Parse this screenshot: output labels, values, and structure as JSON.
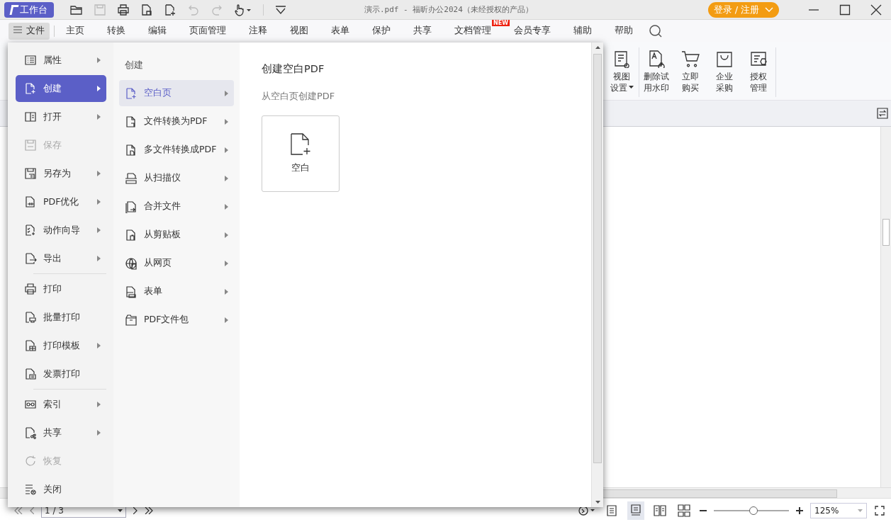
{
  "title_bar": {
    "workbench": "工作台",
    "title": "演示.pdf - 福昕办公2024（未经授权的产品）",
    "login": "登录 / 注册"
  },
  "menu_bar": [
    {
      "label": "文件",
      "selected": true
    },
    {
      "label": "主页",
      "selected": false
    },
    {
      "label": "转换",
      "selected": false
    },
    {
      "label": "编辑",
      "selected": false
    },
    {
      "label": "页面管理",
      "selected": false
    },
    {
      "label": "注释",
      "selected": false
    },
    {
      "label": "视图",
      "selected": false
    },
    {
      "label": "表单",
      "selected": false
    },
    {
      "label": "保护",
      "selected": false
    },
    {
      "label": "共享",
      "selected": false
    },
    {
      "label": "文档管理",
      "selected": false,
      "badge": "NEW"
    },
    {
      "label": "会员专享",
      "selected": false
    },
    {
      "label": "辅助",
      "selected": false
    },
    {
      "label": "帮助",
      "selected": false
    }
  ],
  "ribbon": [
    {
      "lines": [
        "视图",
        "设置"
      ],
      "dropdown": true
    },
    {
      "lines": [
        "删除试",
        "用水印"
      ],
      "dropdown": false
    },
    {
      "lines": [
        "立即",
        "购买"
      ],
      "dropdown": false
    },
    {
      "lines": [
        "企业",
        "采购"
      ],
      "dropdown": false
    },
    {
      "lines": [
        "授权",
        "管理"
      ],
      "dropdown": false
    }
  ],
  "file_menu": {
    "groups": [
      [
        {
          "label": "属性",
          "arrow": true,
          "selected": false,
          "disabled": false
        },
        {
          "label": "创建",
          "arrow": true,
          "selected": true,
          "disabled": false
        },
        {
          "label": "打开",
          "arrow": true,
          "selected": false,
          "disabled": false
        },
        {
          "label": "保存",
          "arrow": false,
          "selected": false,
          "disabled": true
        },
        {
          "label": "另存为",
          "arrow": true,
          "selected": false,
          "disabled": false
        },
        {
          "label": "PDF优化",
          "arrow": true,
          "selected": false,
          "disabled": false
        },
        {
          "label": "动作向导",
          "arrow": true,
          "selected": false,
          "disabled": false
        },
        {
          "label": "导出",
          "arrow": true,
          "selected": false,
          "disabled": false
        }
      ],
      [
        {
          "label": "打印",
          "arrow": false,
          "selected": false,
          "disabled": false
        },
        {
          "label": "批量打印",
          "arrow": false,
          "selected": false,
          "disabled": false
        },
        {
          "label": "打印模板",
          "arrow": true,
          "selected": false,
          "disabled": false
        },
        {
          "label": "发票打印",
          "arrow": false,
          "selected": false,
          "disabled": false
        }
      ],
      [
        {
          "label": "索引",
          "arrow": true,
          "selected": false,
          "disabled": false
        },
        {
          "label": "共享",
          "arrow": true,
          "selected": false,
          "disabled": false
        },
        {
          "label": "恢复",
          "arrow": false,
          "selected": false,
          "disabled": true
        },
        {
          "label": "关闭",
          "arrow": false,
          "selected": false,
          "disabled": false
        }
      ]
    ],
    "submenu": {
      "title": "创建",
      "items": [
        {
          "label": "空白页",
          "selected": true
        },
        {
          "label": "文件转换为PDF",
          "selected": false
        },
        {
          "label": "多文件转换成PDF",
          "selected": false
        },
        {
          "label": "从扫描仪",
          "selected": false
        },
        {
          "label": "合并文件",
          "selected": false
        },
        {
          "label": "从剪贴板",
          "selected": false
        },
        {
          "label": "从网页",
          "selected": false
        },
        {
          "label": "表单",
          "selected": false
        },
        {
          "label": "PDF文件包",
          "selected": false
        }
      ]
    },
    "panel": {
      "title": "创建空白PDF",
      "subtitle": "从空白页创建PDF",
      "card": "空白"
    }
  },
  "status_bar": {
    "page": "1 / 3",
    "view_modes": [
      {
        "selected": false
      },
      {
        "selected": true
      },
      {
        "selected": false
      },
      {
        "selected": false
      }
    ],
    "zoom": {
      "level": 0.53
    },
    "zoom_value": "125%"
  }
}
